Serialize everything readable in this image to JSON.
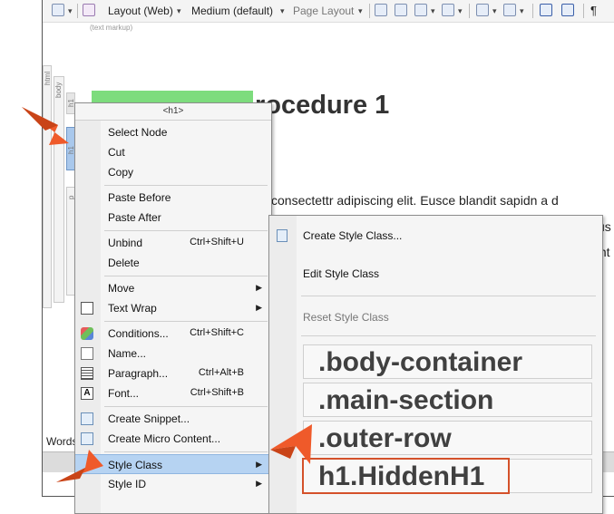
{
  "toolbar": {
    "layout_label": "Layout (Web)",
    "medium_label": "Medium (default)",
    "page_layout_label": "Page Layout"
  },
  "editor": {
    "hint": "(text markup)",
    "heading_text": "rocedure 1",
    "body_line_1": "consectettr adipiscing elit. Eusce blandit sapidn a d",
    "body_line_2": "us",
    "body_line_3": "Int",
    "words_label": "Words"
  },
  "structure_bars": {
    "html": "html",
    "body": "body",
    "h1": "h1",
    "p": "p"
  },
  "context_menu": {
    "title": "<h1>",
    "items": [
      {
        "label": "Select Node"
      },
      {
        "label": "Cut"
      },
      {
        "label": "Copy"
      },
      {
        "label": "Paste Before"
      },
      {
        "label": "Paste After"
      },
      {
        "label": "Unbind",
        "shortcut": "Ctrl+Shift+U"
      },
      {
        "label": "Delete"
      },
      {
        "label": "Move"
      },
      {
        "label": "Text Wrap"
      },
      {
        "label": "Conditions...",
        "shortcut": "Ctrl+Shift+C"
      },
      {
        "label": "Name..."
      },
      {
        "label": "Paragraph...",
        "shortcut": "Ctrl+Alt+B"
      },
      {
        "label": "Font...",
        "shortcut": "Ctrl+Shift+B"
      },
      {
        "label": "Create Snippet..."
      },
      {
        "label": "Create Micro Content..."
      },
      {
        "label": "Style Class"
      },
      {
        "label": "Style ID"
      }
    ]
  },
  "submenu": {
    "create": "Create Style Class...",
    "edit": "Edit Style Class",
    "reset": "Reset Style Class",
    "classes": [
      ".body-container",
      ".main-section",
      ".outer-row",
      "h1.HiddenH1"
    ]
  },
  "colors": {
    "highlight": "#b6d3f2",
    "callout_arrow": "#ef5a2a",
    "heading_green": "#7ddc7d",
    "outline": "#d4512a"
  }
}
